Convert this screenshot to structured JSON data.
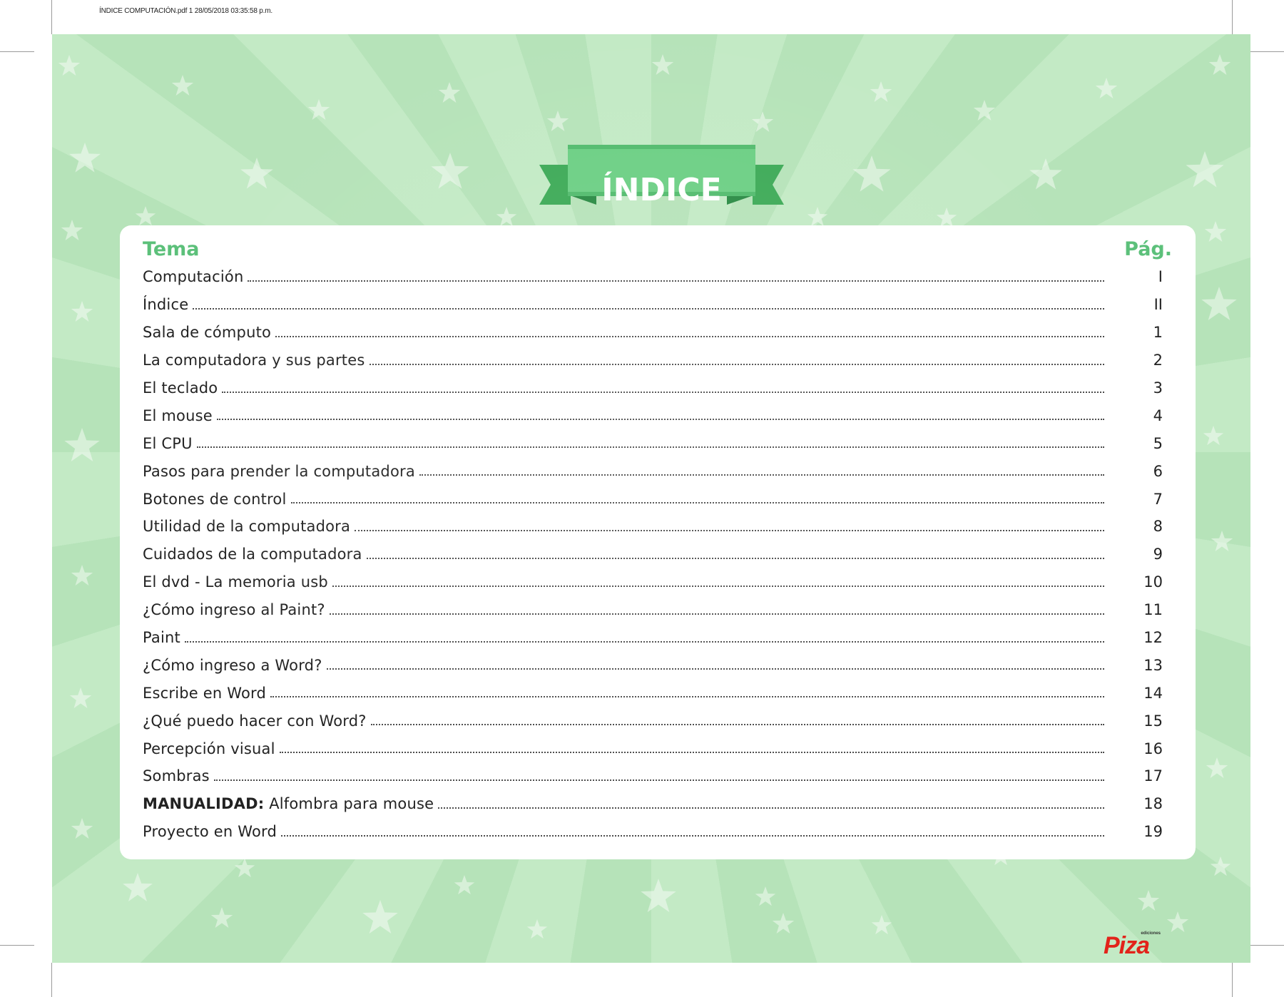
{
  "print_meta": "ÍNDICE COMPUTACIÓN.pdf   1   28/05/2018   03:35:58 p.m.",
  "title": "ÍNDICE",
  "header": {
    "topic": "Tema",
    "page": "Pág."
  },
  "entries": [
    {
      "bold": "",
      "text": "Computación",
      "page": "I"
    },
    {
      "bold": "",
      "text": "Índice",
      "page": "II"
    },
    {
      "bold": "",
      "text": "Sala de cómputo",
      "page": "1"
    },
    {
      "bold": "",
      "text": "La computadora y sus partes",
      "page": "2"
    },
    {
      "bold": "",
      "text": "El teclado",
      "page": "3"
    },
    {
      "bold": "",
      "text": "El mouse",
      "page": "4"
    },
    {
      "bold": "",
      "text": "El CPU",
      "page": "5"
    },
    {
      "bold": "",
      "text": "Pasos para prender la computadora",
      "page": "6"
    },
    {
      "bold": "",
      "text": "Botones de control",
      "page": "7"
    },
    {
      "bold": "",
      "text": "Utilidad de la computadora",
      "page": "8"
    },
    {
      "bold": "",
      "text": "Cuidados de la computadora",
      "page": "9"
    },
    {
      "bold": "",
      "text": "El dvd - La memoria usb",
      "page": "10"
    },
    {
      "bold": "",
      "text": "¿Cómo ingreso al Paint?",
      "page": "11"
    },
    {
      "bold": "",
      "text": "Paint",
      "page": "12"
    },
    {
      "bold": "",
      "text": "¿Cómo ingreso a Word?",
      "page": "13"
    },
    {
      "bold": "",
      "text": "Escribe en Word",
      "page": "14"
    },
    {
      "bold": "",
      "text": "¿Qué puedo hacer con Word?",
      "page": "15"
    },
    {
      "bold": "",
      "text": "Percepción visual",
      "page": "16"
    },
    {
      "bold": "",
      "text": "Sombras",
      "page": "17"
    },
    {
      "bold": "MANUALIDAD:",
      "text": "Alfombra para mouse",
      "page": "18"
    },
    {
      "bold": "",
      "text": "Proyecto en Word",
      "page": "19"
    }
  ],
  "logo": {
    "brand": "Piza",
    "tagline": "ediciones"
  },
  "colors": {
    "background_light": "#c3eac5",
    "background_dark": "#b6e3b9",
    "accent_green": "#5cc07a",
    "ribbon_green": "#6ccf84",
    "ribbon_dark": "#3daa57",
    "logo_red": "#e2231a"
  }
}
